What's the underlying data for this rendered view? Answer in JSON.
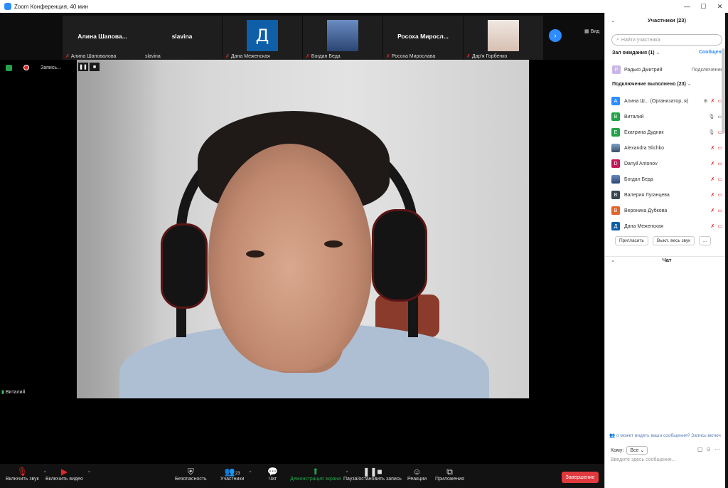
{
  "window": {
    "title": "Zoom Конференция, 40 мин",
    "controls": [
      "—",
      "☐",
      "✕"
    ]
  },
  "strip": {
    "view_label": "Вид",
    "thumbs": [
      {
        "display": "Алина Шапова...",
        "label": "Алина Шаповалова"
      },
      {
        "display": "slavina",
        "label": "slavina"
      },
      {
        "display": "Д",
        "label": "Дана Меженская"
      },
      {
        "display": "",
        "label": "Богдан Беда"
      },
      {
        "display": "Росоха Миросл...",
        "label": "Росоха Мирослава"
      },
      {
        "display": "",
        "label": "Дар'я Горбенко"
      }
    ]
  },
  "recording": {
    "label": "Запись..."
  },
  "video": {
    "speaker": "Виталий"
  },
  "toolbar": {
    "audio": "Включить звук",
    "video": "Включить видео",
    "security": "Безопасность",
    "participants": "Участники",
    "participants_count": "23",
    "chat": "Чат",
    "share": "Демонстрация экрана",
    "record": "Пауза/остановить запись",
    "reactions": "Реакции",
    "apps": "Приложения",
    "end": "Завершение"
  },
  "panel": {
    "title": "Участники (23)",
    "search_placeholder": "Найти участника",
    "waiting_title": "Зал ожидания (1)",
    "message": "Сообщение",
    "waiting_person": {
      "name": "Радько Дмитрий",
      "status": "Подключение...",
      "initial": "Р",
      "color": "#c9b7e6"
    },
    "connected_title": "Подключение выполнено (23)",
    "participants": [
      {
        "initial": "А",
        "name": "Алина Ш...  (Организатор, я)",
        "color": "#2d8cff"
      },
      {
        "initial": "В",
        "name": "Виталий",
        "color": "#23a24a"
      },
      {
        "initial": "Е",
        "name": "Екатрина Дудник",
        "color": "#23a24a"
      },
      {
        "initial": "",
        "name": "Alexandra Slichko",
        "color": "#4a6a8a"
      },
      {
        "initial": "D",
        "name": "Danyil Antonov",
        "color": "#c2185b"
      },
      {
        "initial": "",
        "name": "Богдан Беда",
        "color": "#3b5998"
      },
      {
        "initial": "В",
        "name": "Валерия Луганцева",
        "color": "#37474f"
      },
      {
        "initial": "В",
        "name": "Вероника Дубкова",
        "color": "#e0662a"
      },
      {
        "initial": "Д",
        "name": "Дана Меженская",
        "color": "#0e5ea8"
      }
    ],
    "invite": "Пригласить",
    "mute_all": "Выкл. весь звук",
    "more": "...",
    "chat_title": "Чат",
    "chat_note": "о может видеть ваши сообщения? Запись включ",
    "chat_to_label": "Кому:",
    "chat_to_value": "Все",
    "chat_placeholder": "Введите здесь сообщение..."
  }
}
